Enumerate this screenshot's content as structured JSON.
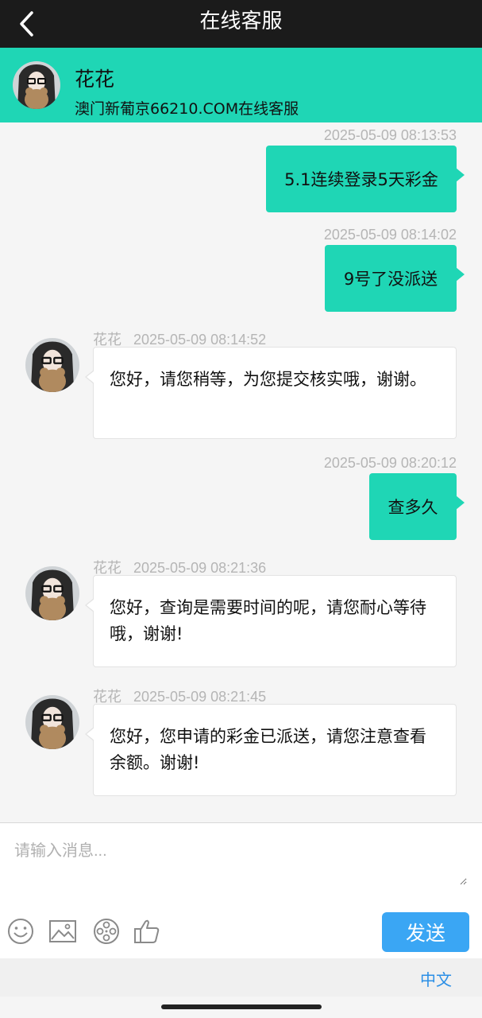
{
  "header": {
    "title": "在线客服"
  },
  "agent": {
    "name": "花花",
    "subtitle": "澳门新葡京66210.COM在线客服"
  },
  "messages": [
    {
      "side": "out",
      "time": "2025-05-09 08:13:53",
      "text": "5.1连续登录5天彩金"
    },
    {
      "side": "out",
      "time": "2025-05-09 08:14:02",
      "text": "9号了没派送"
    },
    {
      "side": "in",
      "sender": "花花",
      "time": "2025-05-09 08:14:52",
      "text": "您好，请您稍等，为您提交核实哦，谢谢。"
    },
    {
      "side": "out",
      "time": "2025-05-09 08:20:12",
      "text": "查多久"
    },
    {
      "side": "in",
      "sender": "花花",
      "time": "2025-05-09 08:21:36",
      "text": "您好，查询是需要时间的呢，请您耐心等待哦，谢谢!"
    },
    {
      "side": "in",
      "sender": "花花",
      "time": "2025-05-09 08:21:45",
      "text": "您好，您申请的彩金已派送，请您注意查看余额。谢谢!"
    }
  ],
  "composer": {
    "placeholder": "请输入消息...",
    "send_label": "发送"
  },
  "toolbar_icons": [
    "emoji-icon",
    "image-icon",
    "film-reel-icon",
    "thumbs-up-icon"
  ],
  "footer": {
    "language": "中文"
  },
  "colors": {
    "accent": "#1fd6b5",
    "send": "#3aa6f4",
    "topbar": "#1b1b1b"
  }
}
